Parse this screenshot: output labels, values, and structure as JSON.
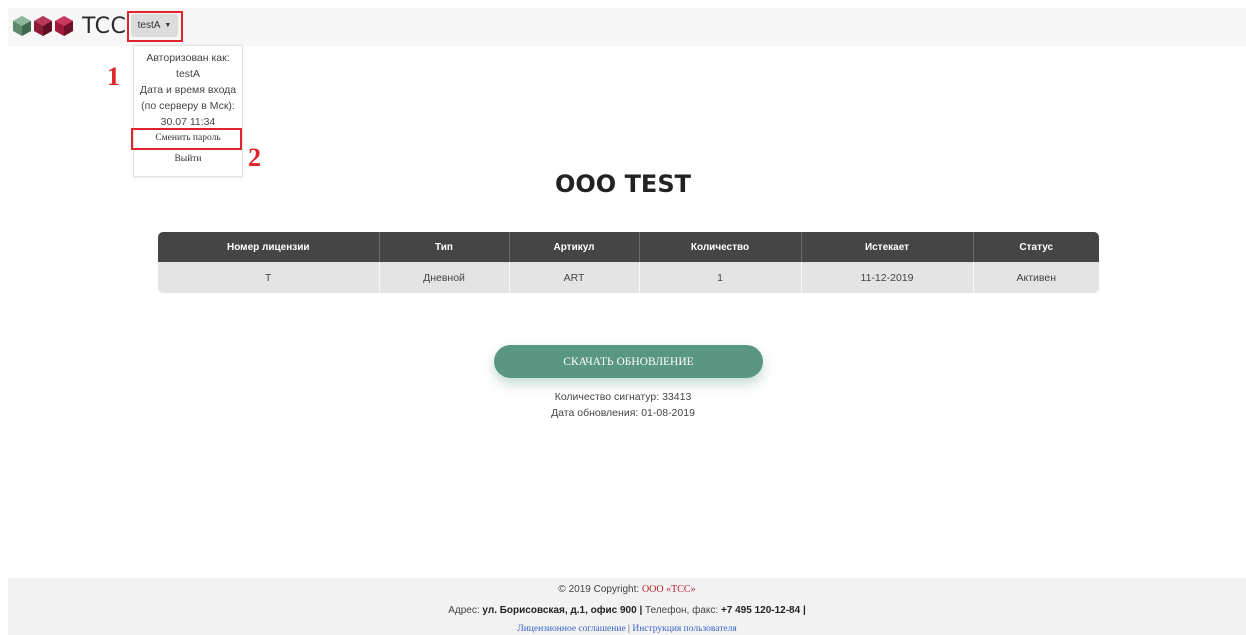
{
  "header": {
    "logo_text": "TCC",
    "user_button_label": "testA"
  },
  "dropdown": {
    "authorized_as_label": "Авторизован как:",
    "username": "testA",
    "login_datetime_label_1": "Дата и время входа",
    "login_datetime_label_2": "(по серверу в Мск):",
    "login_datetime": "30.07 11:34",
    "change_password": "Сменить пароль",
    "logout": "Выйти"
  },
  "annotations": {
    "marker_1": "1",
    "marker_2": "2",
    "color": "#e0242b"
  },
  "company": {
    "name": "OOO TEST"
  },
  "license_table": {
    "headers": [
      "Номер лицензии",
      "Тип",
      "Артикул",
      "Количество",
      "Истекает",
      "Статус"
    ],
    "rows": [
      [
        "T",
        "Дневной",
        "ART",
        "1",
        "11-12-2019",
        "Активен"
      ]
    ]
  },
  "update": {
    "download_button": "СКАЧАТЬ ОБНОВЛЕНИЕ",
    "signature_count": "Количество сигнатур: 33413",
    "update_date": "Дата обновления: 01-08-2019",
    "accent_color": "#5a9783"
  },
  "footer": {
    "copyright_prefix": "© 2019 Copyright:",
    "copyright_company": "ООО «ТСС»",
    "address_label": "Адрес:",
    "address_value": "ул. Борисовская, д.1, офис 900",
    "separator": "|",
    "phone_label": "Телефон, факс:",
    "phone_value": "+7 495 120-12-84",
    "license_agreement_link": "Лицензионное соглашение",
    "user_manual_link": "Инструкция пользователя"
  }
}
